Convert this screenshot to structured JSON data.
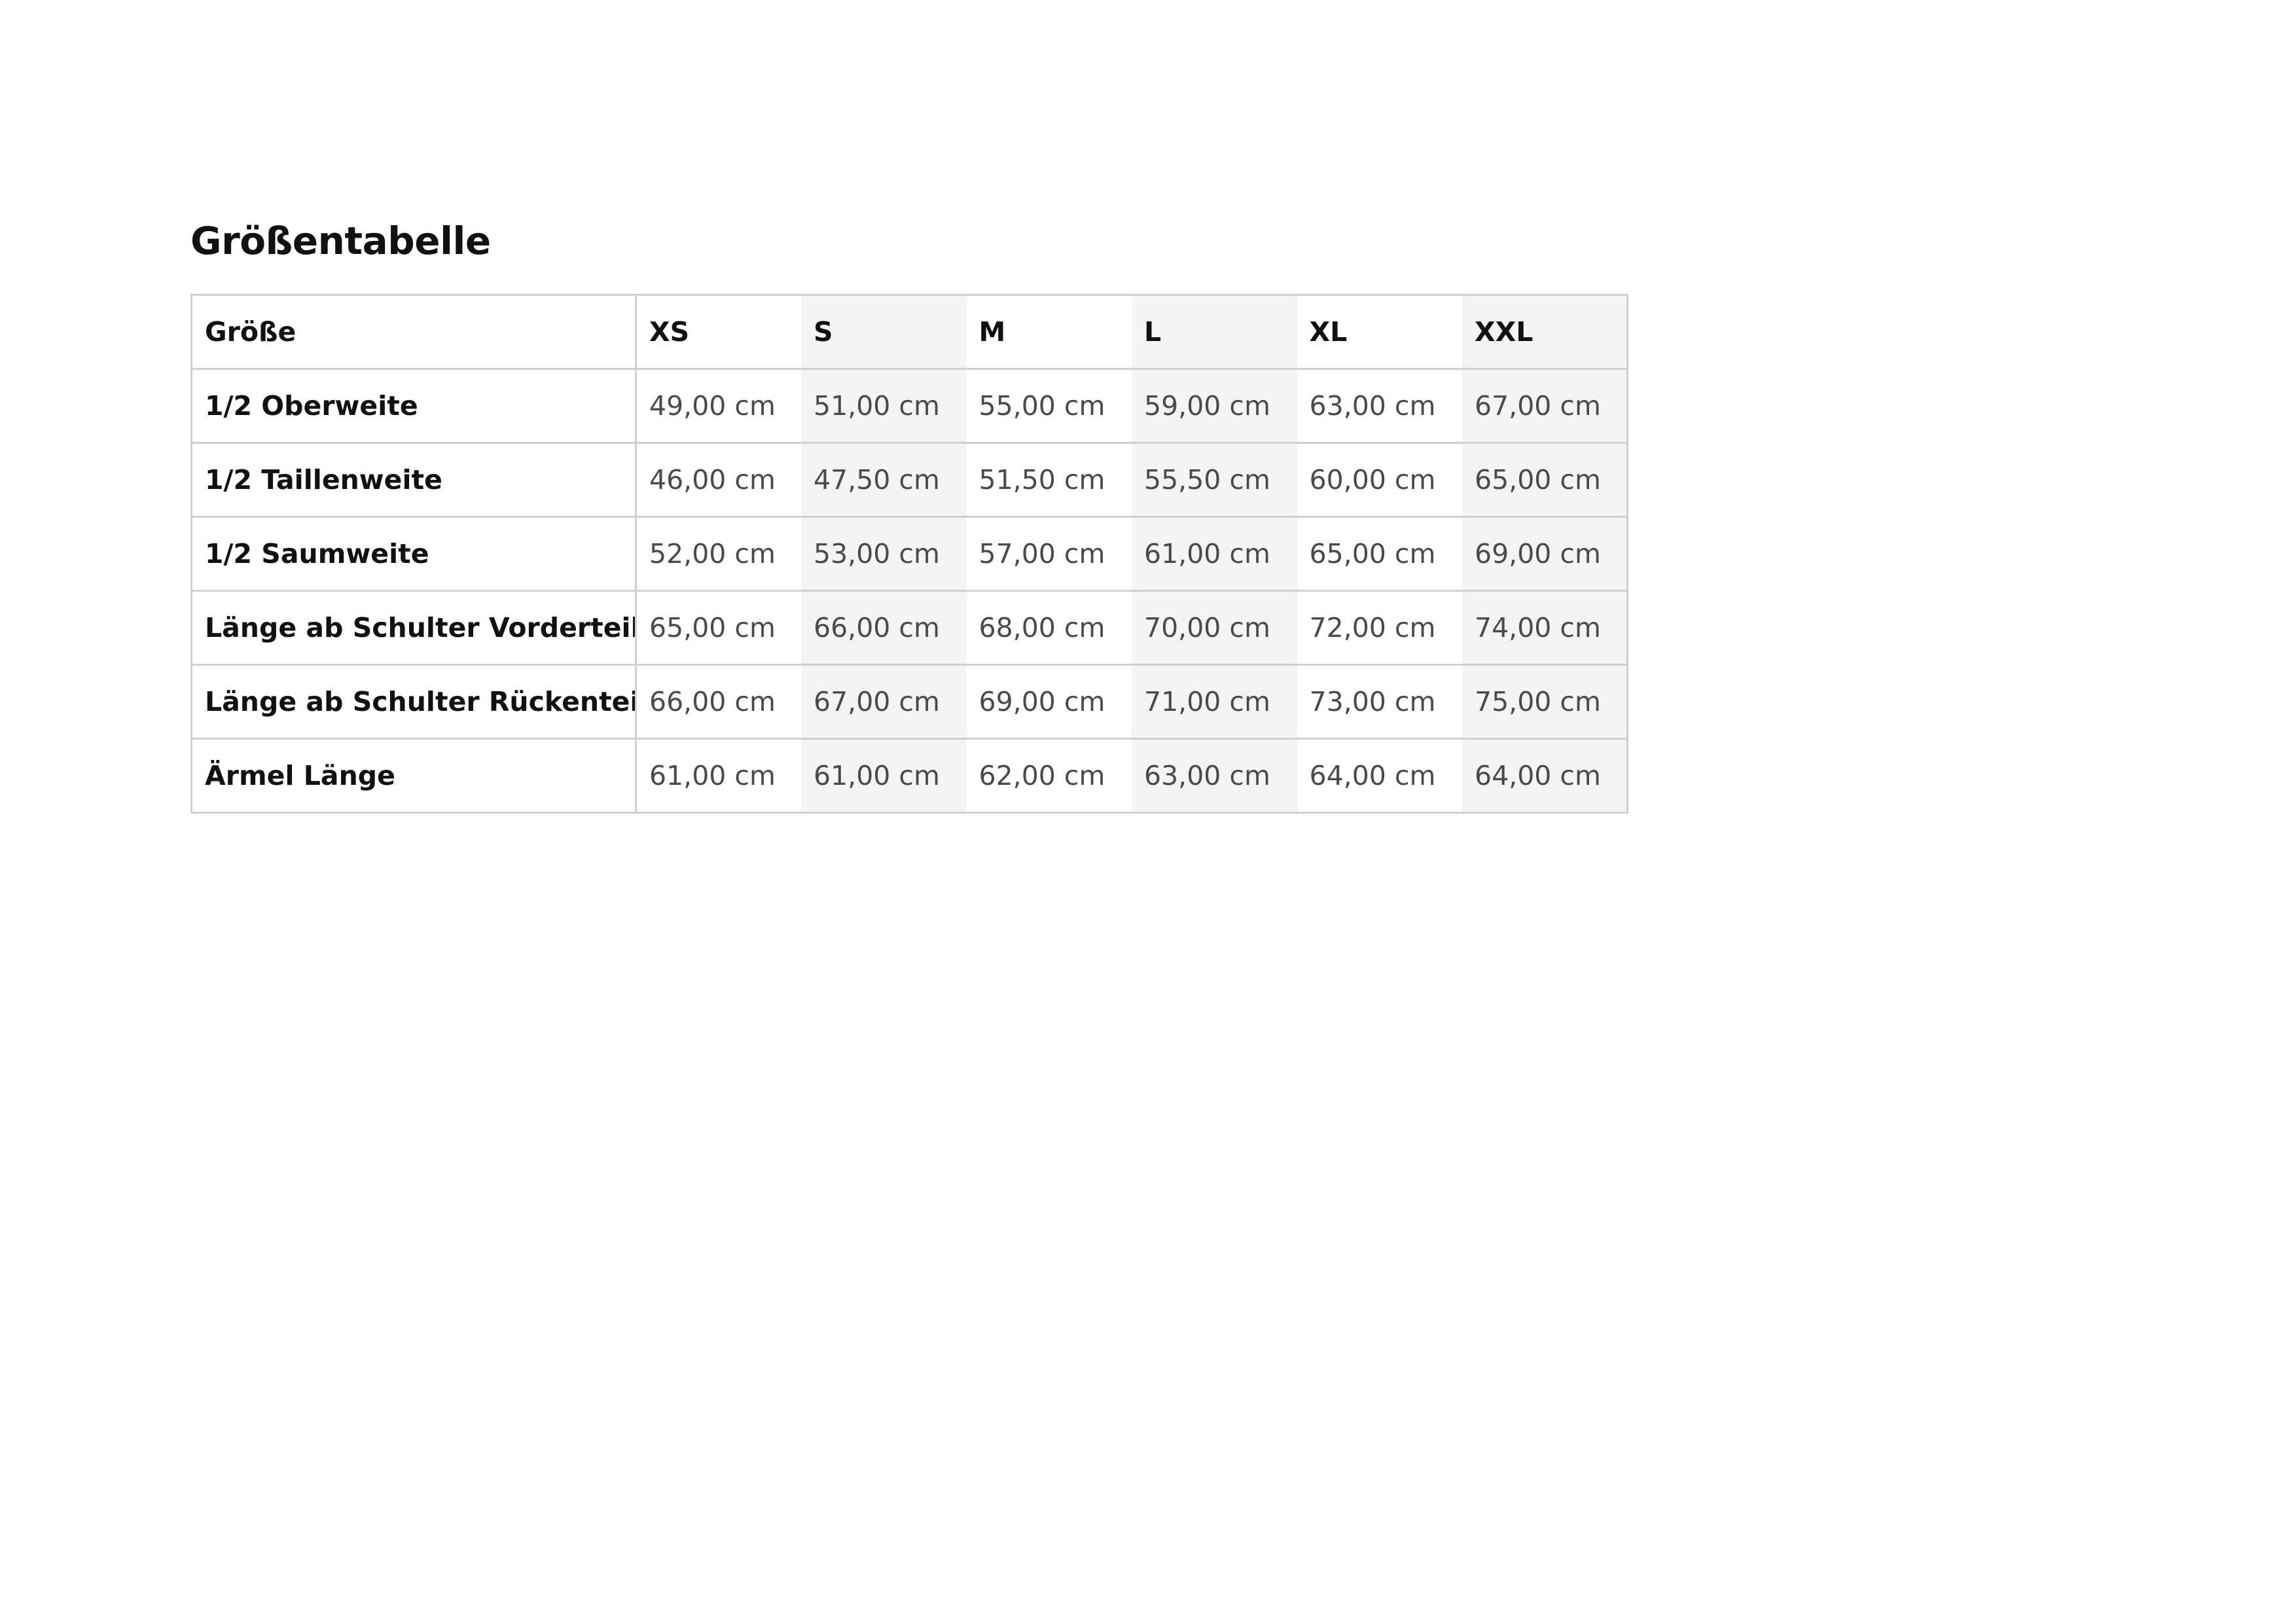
{
  "page": {
    "title": "Größentabelle"
  },
  "table": {
    "header_label": "Größe",
    "sizes": [
      "XS",
      "S",
      "M",
      "L",
      "XL",
      "XXL"
    ],
    "rows": [
      {
        "label": "1/2 Oberweite",
        "values": [
          "49,00 cm",
          "51,00 cm",
          "55,00 cm",
          "59,00 cm",
          "63,00 cm",
          "67,00 cm"
        ]
      },
      {
        "label": "1/2 Taillenweite",
        "values": [
          "46,00 cm",
          "47,50 cm",
          "51,50 cm",
          "55,50 cm",
          "60,00 cm",
          "65,00 cm"
        ]
      },
      {
        "label": "1/2 Saumweite",
        "values": [
          "52,00 cm",
          "53,00 cm",
          "57,00 cm",
          "61,00 cm",
          "65,00 cm",
          "69,00 cm"
        ]
      },
      {
        "label": "Länge ab Schulter Vorderteil",
        "values": [
          "65,00 cm",
          "66,00 cm",
          "68,00 cm",
          "70,00 cm",
          "72,00 cm",
          "74,00 cm"
        ]
      },
      {
        "label": "Länge ab Schulter Rückenteil",
        "values": [
          "66,00 cm",
          "67,00 cm",
          "69,00 cm",
          "71,00 cm",
          "73,00 cm",
          "75,00 cm"
        ]
      },
      {
        "label": "Ärmel Länge",
        "values": [
          "61,00 cm",
          "61,00 cm",
          "62,00 cm",
          "63,00 cm",
          "64,00 cm",
          "64,00 cm"
        ]
      }
    ]
  },
  "colors": {
    "text": "#111111",
    "cell_text": "#4a4a4a",
    "border": "#cfcfcf",
    "alt_column": "#f4f4f4"
  }
}
